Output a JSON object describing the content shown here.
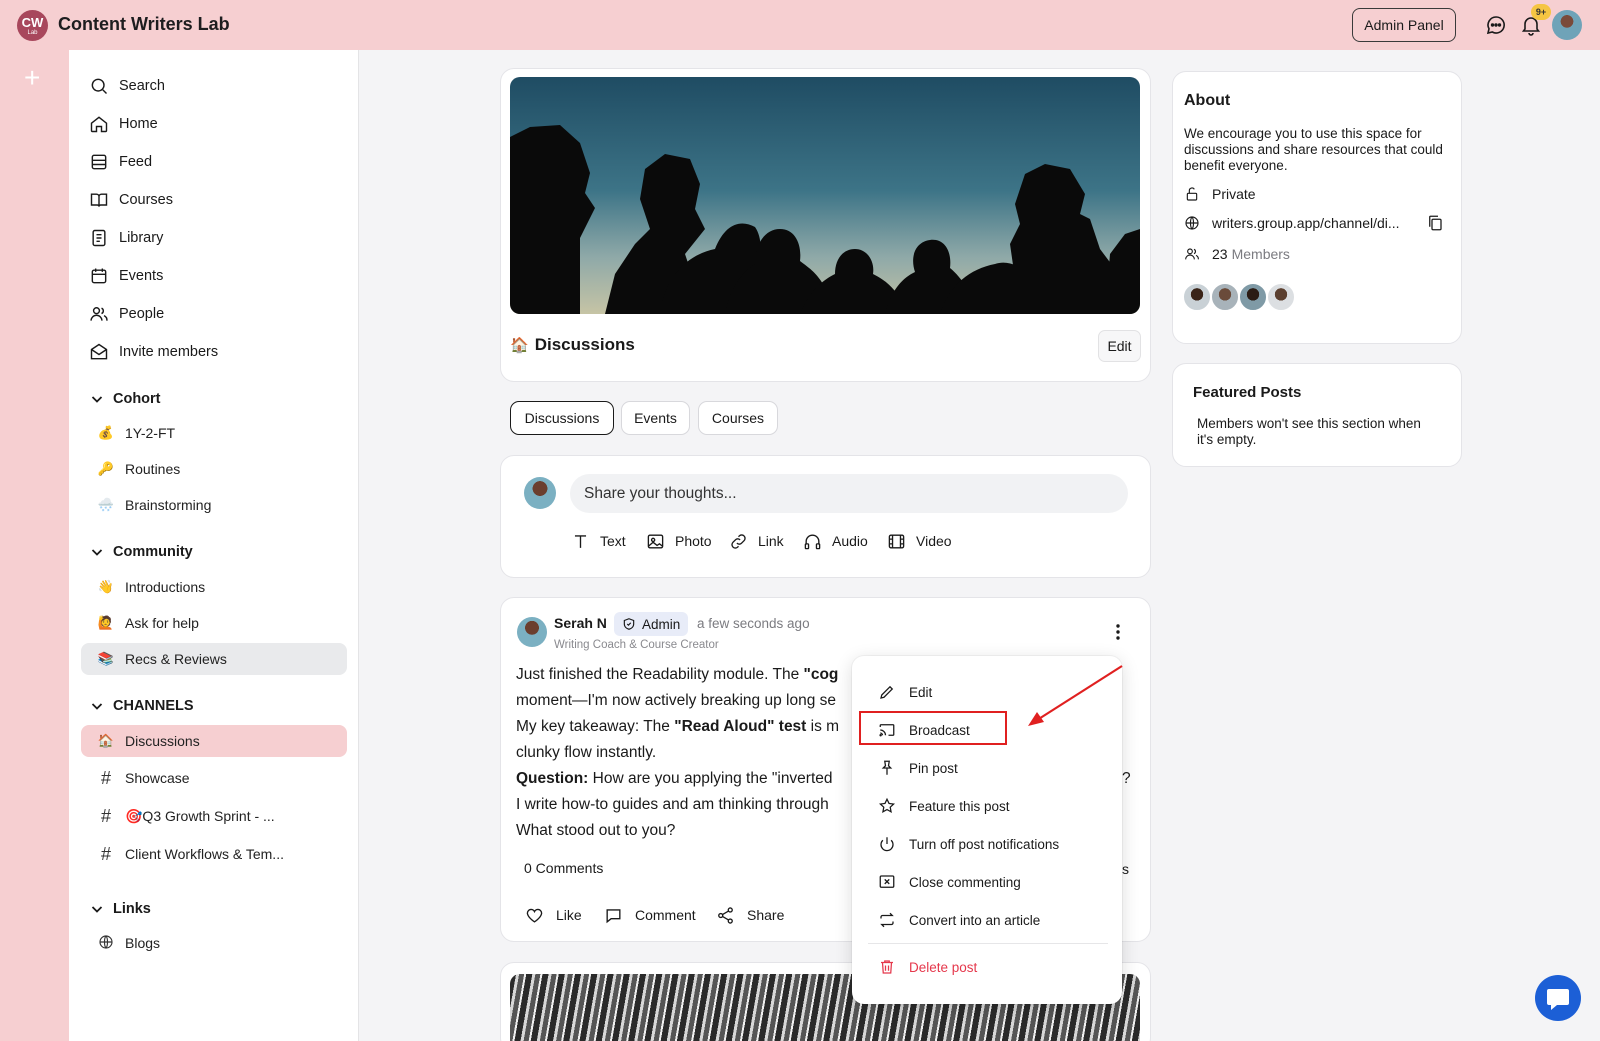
{
  "app": {
    "logo_text": "CW",
    "logo_sub": "Lab",
    "brand": "Content Writers Lab",
    "admin_label": "Admin Panel",
    "notif_count": "9+"
  },
  "sidebar": {
    "nav": [
      {
        "label": "Search",
        "icon": "search-icon"
      },
      {
        "label": "Home",
        "icon": "home-icon"
      },
      {
        "label": "Feed",
        "icon": "feed-icon"
      },
      {
        "label": "Courses",
        "icon": "book-icon"
      },
      {
        "label": "Library",
        "icon": "library-icon"
      },
      {
        "label": "Events",
        "icon": "calendar-icon"
      },
      {
        "label": "People",
        "icon": "people-icon"
      },
      {
        "label": "Invite members",
        "icon": "mail-icon"
      }
    ],
    "cohort": {
      "title": "Cohort",
      "items": [
        {
          "emoji": "💰",
          "label": "1Y-2-FT"
        },
        {
          "emoji": "🔑",
          "label": "Routines"
        },
        {
          "emoji": "🌨️",
          "label": "Brainstorming"
        }
      ]
    },
    "community": {
      "title": "Community",
      "items": [
        {
          "emoji": "👋",
          "label": "Introductions"
        },
        {
          "emoji": "🙋",
          "label": "Ask for help"
        },
        {
          "emoji": "📚",
          "label": "Recs & Reviews"
        }
      ]
    },
    "channels": {
      "title": "CHANNELS",
      "items": [
        {
          "emoji": "🏠",
          "label": "Discussions"
        },
        {
          "emoji": "#",
          "label": "Showcase"
        },
        {
          "emoji": "#",
          "label": "🎯Q3 Growth Sprint - ..."
        },
        {
          "emoji": "#",
          "label": "Client Workflows & Tem..."
        }
      ]
    },
    "links": {
      "title": "Links",
      "items": [
        {
          "label": "Blogs",
          "icon": "globe-icon"
        }
      ]
    }
  },
  "channel": {
    "emoji": "🏠",
    "title": "Discussions",
    "edit_label": "Edit"
  },
  "tabs": [
    "Discussions",
    "Events",
    "Courses"
  ],
  "composer": {
    "placeholder": "Share your thoughts...",
    "tools": [
      "Text",
      "Photo",
      "Link",
      "Audio",
      "Video"
    ]
  },
  "post": {
    "author": "Serah N",
    "badge": "Admin",
    "time": "a few seconds ago",
    "subtitle": "Writing Coach & Course Creator",
    "line1_a": "Just finished the Readability module. The ",
    "line1_b": "\"cog",
    "line2": "moment—I'm now actively breaking up long se",
    "line3_a": "My key takeaway: The ",
    "line3_b": "\"Read Aloud\" test",
    "line3_c": " is m",
    "line4": "clunky flow instantly.",
    "line5_a": "Question:",
    "line5_b": " How are you applying the \"inverted",
    "line5_tail": "?",
    "line6": "I write how-to guides and am thinking through",
    "line7": "What stood out to you?",
    "comments": "0 Comments",
    "comments_tail": "s",
    "actions": [
      "Like",
      "Comment",
      "Share"
    ]
  },
  "menu": {
    "items": [
      {
        "label": "Edit",
        "icon": "pencil-icon"
      },
      {
        "label": "Broadcast",
        "icon": "cast-icon"
      },
      {
        "label": "Pin post",
        "icon": "pin-icon"
      },
      {
        "label": "Feature this post",
        "icon": "star-icon"
      },
      {
        "label": "Turn off post notifications",
        "icon": "power-icon"
      },
      {
        "label": "Close commenting",
        "icon": "close-comment-icon"
      },
      {
        "label": "Convert into an article",
        "icon": "convert-icon"
      }
    ],
    "delete_label": "Delete post"
  },
  "about": {
    "title": "About",
    "text": "We encourage you to use this space for discussions and share resources that could benefit everyone.",
    "privacy": "Private",
    "url": "writers.group.app/channel/di...",
    "member_count": "23",
    "member_label": "Members"
  },
  "featured": {
    "title": "Featured Posts",
    "text": "Members won't see this section when it's empty."
  },
  "colors": {
    "accent": "#f6cfd1",
    "danger": "#e5384c",
    "highlight": "#e02020",
    "fab": "#1c5fd6"
  }
}
